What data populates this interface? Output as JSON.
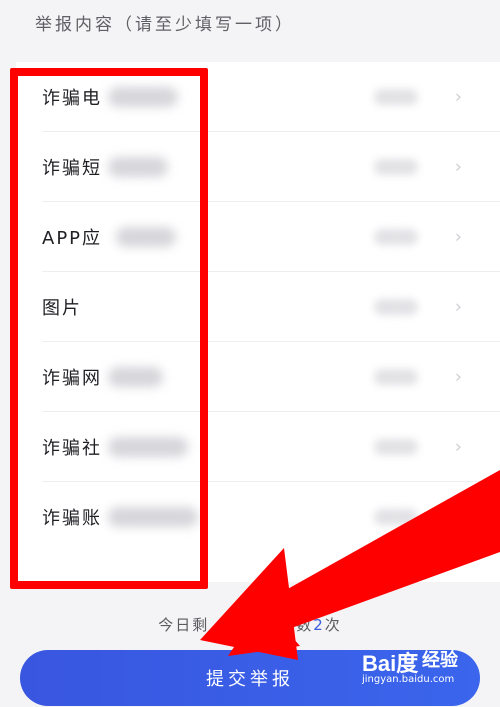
{
  "section": {
    "title": "举报内容（请至少填写一项）"
  },
  "items": [
    {
      "label": "诈骗电"
    },
    {
      "label": "诈骗短"
    },
    {
      "label": "APP应"
    },
    {
      "label": "图片"
    },
    {
      "label": "诈骗网"
    },
    {
      "label": "诈骗社"
    },
    {
      "label": "诈骗账"
    }
  ],
  "footer": {
    "remaining_prefix": "今日剩",
    "remaining_suffix": "次数",
    "remaining_count": "2",
    "remaining_unit": "次",
    "submit_label": "提交举报"
  },
  "watermark": {
    "logo": "Bai度",
    "brand": "经验",
    "url": "jingyan.baidu.com"
  },
  "colors": {
    "accent": "#3956e0",
    "annotation": "#ff0000"
  }
}
